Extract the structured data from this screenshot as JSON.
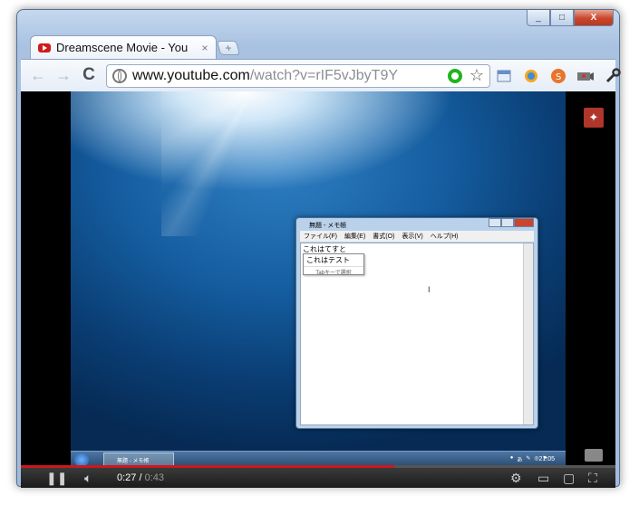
{
  "window": {
    "controls": {
      "minimize": "_",
      "maximize": "□",
      "close": "X"
    }
  },
  "tab": {
    "title": "Dreamscene Movie - You",
    "close": "×"
  },
  "toolbar": {
    "back": "←",
    "forward": "→",
    "reload": "C",
    "url_host": "www.youtube.com",
    "url_path": "/watch?v=rIF5vJbyT9Y",
    "star": "☆",
    "extensions": [
      "page-icon",
      "settings-gear-icon",
      "scroll-icon",
      "camera-icon",
      "wrench-icon"
    ]
  },
  "notepad": {
    "title": "無題 - メモ帳",
    "menu": [
      "ファイル(F)",
      "編集(E)",
      "書式(O)",
      "表示(V)",
      "ヘルプ(H)"
    ],
    "typed_text": "これはてすと",
    "ime_candidate": "これはテスト",
    "ime_hint": "Tabキーで選択"
  },
  "taskbar": {
    "item_label": "無題 - メモ帳",
    "clock": "21:05"
  },
  "player": {
    "current_time": "0:27",
    "duration": "0:43",
    "progress_fraction": 0.628,
    "accent": "#cc181e"
  }
}
